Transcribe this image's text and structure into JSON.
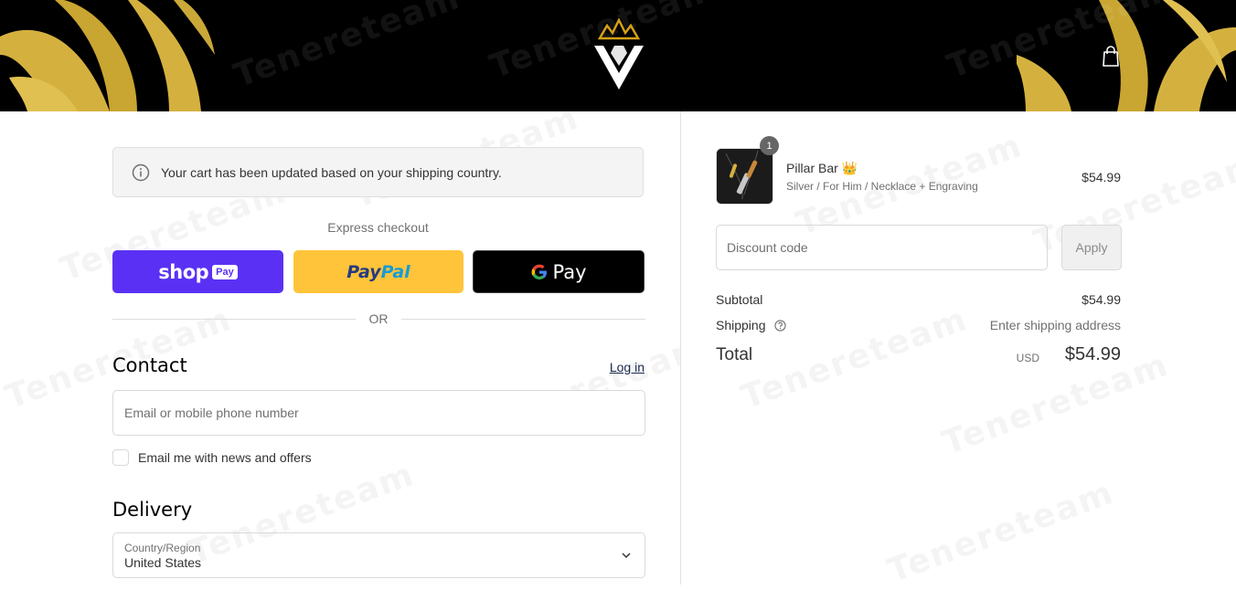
{
  "header": {
    "logo_icon": "crown-v-logo",
    "cart_icon": "shopping-bag-icon",
    "brand_colors": {
      "gold": "#d4b13f",
      "black": "#000000"
    }
  },
  "notice": {
    "icon": "info-icon",
    "text": "Your cart has been updated based on your shipping country."
  },
  "express": {
    "label": "Express checkout",
    "shop_pay": {
      "text": "shop",
      "badge": "Pay",
      "color": "#5a31f4"
    },
    "paypal": {
      "text_pay": "Pay",
      "text_pal": "Pal",
      "color": "#ffc439"
    },
    "gpay": {
      "text": "Pay",
      "color": "#000000"
    },
    "or": "OR"
  },
  "contact": {
    "title": "Contact",
    "login": "Log in",
    "email_placeholder": "Email or mobile phone number",
    "newsletter_label": "Email me with news and offers"
  },
  "delivery": {
    "title": "Delivery",
    "country_label": "Country/Region",
    "country_value": "United States"
  },
  "order": {
    "item": {
      "qty": "1",
      "name": "Pillar Bar 👑",
      "variant": "Silver / For Him / Necklace + Engraving",
      "price": "$54.99"
    },
    "discount_placeholder": "Discount code",
    "apply": "Apply",
    "subtotal_label": "Subtotal",
    "subtotal_value": "$54.99",
    "shipping_label": "Shipping",
    "shipping_value": "Enter shipping address",
    "total_label": "Total",
    "total_currency": "USD",
    "total_value": "$54.99"
  },
  "watermark": "Tenereteam"
}
